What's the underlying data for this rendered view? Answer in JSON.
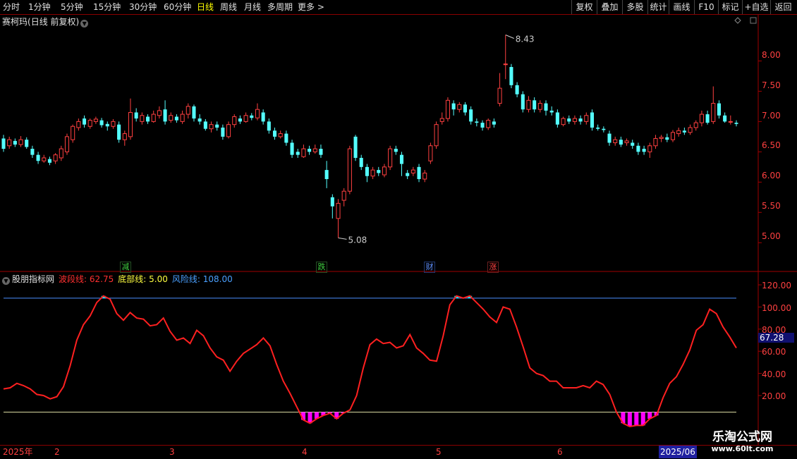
{
  "toolbar": {
    "periods": [
      "分时",
      "1分钟",
      "5分钟",
      "15分钟",
      "30分钟",
      "60分钟",
      "日线",
      "周线",
      "月线",
      "多周期",
      "更多"
    ],
    "active_period": "日线",
    "tools": [
      "复权",
      "叠加",
      "多股",
      "统计",
      "画线",
      "F10",
      "标记",
      "+自选",
      "返回"
    ]
  },
  "stock": {
    "name": "赛柯玛",
    "mode": "(日线 前复权)"
  },
  "price_axis": {
    "labels": [
      "8.00",
      "7.50",
      "7.00",
      "6.50",
      "6.00",
      "5.50",
      "5.00"
    ]
  },
  "annotations": {
    "high": "8.43",
    "low": "5.08"
  },
  "events": [
    {
      "label": "减",
      "color": "#40d040"
    },
    {
      "label": "跌",
      "color": "#40d040"
    },
    {
      "label": "财",
      "color": "#6090ff"
    },
    {
      "label": "涨",
      "color": "#ff4040"
    }
  ],
  "indicator": {
    "name": "股朋指标网",
    "wave_label": "波段线:",
    "wave_value": "62.75",
    "bottom_label": "底部线:",
    "bottom_value": "5.00",
    "risk_label": "风险线:",
    "risk_value": "108.00",
    "axis_labels": [
      "120.00",
      "100.00",
      "80.00",
      "60.00",
      "40.00",
      "20.00"
    ],
    "current_marker": "67.28"
  },
  "dates": {
    "labels": [
      "2025年",
      "2",
      "3",
      "4",
      "5",
      "6",
      "2025/06"
    ]
  },
  "watermark": {
    "line1": "乐淘公式网",
    "line2": "www.60lt.com"
  },
  "chart_data": {
    "type": "candlestick",
    "price_ylim": [
      4.7,
      8.75
    ],
    "indicator_ylim": [
      -5,
      125
    ],
    "wave_line": [
      26,
      27,
      31,
      29,
      26,
      21,
      20,
      17,
      19,
      28,
      47,
      70,
      84,
      92,
      104,
      110,
      107,
      94,
      88,
      95,
      90,
      89,
      83,
      84,
      90,
      78,
      70,
      72,
      67,
      79,
      74,
      63,
      55,
      52,
      42,
      51,
      58,
      62,
      66,
      72,
      65,
      48,
      33,
      22,
      10,
      -2,
      -5,
      -1,
      2,
      4,
      -1,
      4,
      7,
      20,
      45,
      66,
      71,
      67,
      68,
      63,
      65,
      75,
      63,
      58,
      52,
      51,
      74,
      102,
      110,
      108,
      110,
      104,
      98,
      91,
      86,
      100,
      98,
      82,
      64,
      45,
      40,
      38,
      33,
      33,
      27,
      27,
      27,
      29,
      27,
      33,
      30,
      21,
      5,
      -5,
      -8,
      -7,
      -7,
      -1,
      2,
      18,
      31,
      37,
      48,
      61,
      79,
      84,
      98,
      94,
      82,
      73,
      63
    ],
    "risk_line": 108,
    "bottom_line": 5,
    "candles": [
      [
        6.72,
        6.55,
        6.78,
        6.5
      ],
      [
        6.6,
        6.7,
        6.75,
        6.55
      ],
      [
        6.68,
        6.62,
        6.72,
        6.58
      ],
      [
        6.62,
        6.7,
        6.76,
        6.58
      ],
      [
        6.7,
        6.58,
        6.74,
        6.55
      ],
      [
        6.55,
        6.45,
        6.6,
        6.4
      ],
      [
        6.45,
        6.35,
        6.5,
        6.3
      ],
      [
        6.35,
        6.4,
        6.45,
        6.32
      ],
      [
        6.38,
        6.32,
        6.42,
        6.28
      ],
      [
        6.35,
        6.45,
        6.48,
        6.3
      ],
      [
        6.4,
        6.55,
        6.6,
        6.35
      ],
      [
        6.5,
        6.75,
        6.8,
        6.45
      ],
      [
        6.7,
        6.92,
        6.95,
        6.65
      ],
      [
        6.9,
        7.0,
        7.05,
        6.85
      ],
      [
        7.05,
        6.95,
        7.1,
        6.9
      ],
      [
        6.92,
        7.02,
        7.05,
        6.88
      ],
      [
        7.0,
        7.04,
        7.08,
        6.96
      ],
      [
        7.02,
        6.94,
        7.06,
        6.9
      ],
      [
        6.96,
        6.92,
        7.0,
        6.85
      ],
      [
        6.92,
        7.0,
        7.04,
        6.88
      ],
      [
        6.95,
        6.7,
        7.0,
        6.65
      ],
      [
        6.7,
        6.8,
        6.85,
        6.6
      ],
      [
        6.75,
        7.15,
        7.38,
        6.7
      ],
      [
        7.15,
        7.05,
        7.22,
        7.0
      ],
      [
        7.0,
        7.1,
        7.15,
        6.95
      ],
      [
        7.08,
        7.0,
        7.12,
        6.96
      ],
      [
        7.0,
        7.12,
        7.18,
        6.98
      ],
      [
        7.1,
        7.18,
        7.25,
        7.05
      ],
      [
        7.2,
        7.0,
        7.35,
        6.95
      ],
      [
        7.02,
        7.1,
        7.15,
        6.98
      ],
      [
        7.08,
        7.02,
        7.12,
        6.98
      ],
      [
        7.0,
        7.12,
        7.18,
        6.96
      ],
      [
        7.12,
        7.25,
        7.3,
        7.05
      ],
      [
        7.25,
        7.05,
        7.28,
        7.0
      ],
      [
        7.05,
        7.0,
        7.12,
        6.95
      ],
      [
        7.0,
        6.88,
        7.04,
        6.85
      ],
      [
        6.88,
        6.95,
        7.0,
        6.82
      ],
      [
        6.95,
        6.9,
        7.0,
        6.85
      ],
      [
        6.9,
        6.75,
        6.95,
        6.7
      ],
      [
        6.75,
        6.95,
        7.0,
        6.72
      ],
      [
        6.95,
        7.08,
        7.12,
        6.9
      ],
      [
        7.05,
        7.0,
        7.1,
        6.96
      ],
      [
        7.0,
        7.1,
        7.15,
        6.98
      ],
      [
        7.1,
        7.06,
        7.14,
        7.02
      ],
      [
        7.06,
        7.2,
        7.3,
        7.02
      ],
      [
        7.15,
        7.0,
        7.2,
        6.95
      ],
      [
        7.0,
        6.85,
        7.05,
        6.8
      ],
      [
        6.85,
        6.75,
        6.9,
        6.7
      ],
      [
        6.75,
        6.8,
        6.85,
        6.72
      ],
      [
        6.8,
        6.65,
        6.85,
        6.6
      ],
      [
        6.65,
        6.45,
        6.7,
        6.4
      ],
      [
        6.5,
        6.45,
        6.55,
        6.4
      ],
      [
        6.42,
        6.55,
        6.62,
        6.4
      ],
      [
        6.55,
        6.5,
        6.6,
        6.45
      ],
      [
        6.5,
        6.55,
        6.62,
        6.47
      ],
      [
        6.55,
        6.45,
        6.62,
        6.4
      ],
      [
        6.2,
        6.05,
        6.35,
        5.9
      ],
      [
        5.75,
        5.6,
        5.8,
        5.4
      ],
      [
        5.4,
        5.65,
        5.72,
        5.08
      ],
      [
        5.7,
        5.85,
        5.9,
        5.6
      ],
      [
        5.85,
        6.55,
        6.6,
        5.8
      ],
      [
        6.75,
        6.4,
        6.78,
        6.35
      ],
      [
        6.4,
        6.25,
        6.45,
        6.2
      ],
      [
        6.25,
        6.1,
        6.3,
        6.0
      ],
      [
        6.1,
        6.2,
        6.25,
        6.05
      ],
      [
        6.2,
        6.15,
        6.25,
        6.1
      ],
      [
        6.12,
        6.25,
        6.3,
        6.08
      ],
      [
        6.25,
        6.55,
        6.6,
        6.2
      ],
      [
        6.55,
        6.5,
        6.6,
        6.45
      ],
      [
        6.45,
        6.3,
        6.5,
        6.1
      ],
      [
        6.15,
        6.1,
        6.2,
        6.05
      ],
      [
        6.15,
        6.2,
        6.25,
        6.1
      ],
      [
        6.25,
        6.05,
        6.3,
        6.0
      ],
      [
        6.05,
        6.15,
        6.2,
        6.0
      ],
      [
        6.35,
        6.6,
        6.65,
        6.3
      ],
      [
        6.6,
        6.95,
        7.0,
        6.55
      ],
      [
        7.0,
        7.05,
        7.15,
        6.95
      ],
      [
        7.05,
        7.35,
        7.4,
        7.0
      ],
      [
        7.3,
        7.2,
        7.35,
        7.1
      ],
      [
        7.2,
        7.28,
        7.32,
        7.15
      ],
      [
        7.28,
        7.15,
        7.32,
        7.1
      ],
      [
        7.2,
        7.0,
        7.25,
        6.95
      ],
      [
        7.0,
        6.98,
        7.05,
        6.92
      ],
      [
        6.98,
        6.9,
        7.02,
        6.85
      ],
      [
        6.9,
        7.02,
        7.05,
        6.86
      ],
      [
        7.0,
        6.95,
        7.05,
        6.9
      ],
      [
        7.3,
        7.55,
        7.8,
        7.25
      ],
      [
        7.95,
        7.95,
        8.43,
        7.7
      ],
      [
        7.9,
        7.6,
        7.95,
        7.55
      ],
      [
        7.6,
        7.45,
        7.65,
        7.4
      ],
      [
        7.45,
        7.2,
        7.5,
        7.15
      ],
      [
        7.2,
        7.35,
        7.42,
        7.15
      ],
      [
        7.35,
        7.2,
        7.4,
        7.15
      ],
      [
        7.2,
        7.3,
        7.35,
        7.15
      ],
      [
        7.3,
        7.18,
        7.35,
        7.1
      ],
      [
        7.18,
        7.15,
        7.25,
        7.1
      ],
      [
        7.15,
        6.95,
        7.2,
        6.9
      ],
      [
        6.95,
        7.05,
        7.08,
        6.92
      ],
      [
        7.05,
        7.0,
        7.1,
        6.96
      ],
      [
        7.0,
        7.05,
        7.1,
        6.95
      ],
      [
        7.05,
        7.0,
        7.1,
        6.95
      ],
      [
        7.0,
        7.1,
        7.15,
        6.95
      ],
      [
        7.15,
        6.9,
        7.2,
        6.85
      ],
      [
        6.9,
        6.88,
        6.95,
        6.85
      ],
      [
        6.88,
        6.86,
        6.92,
        6.82
      ],
      [
        6.8,
        6.65,
        6.85,
        6.6
      ],
      [
        6.65,
        6.7,
        6.75,
        6.6
      ],
      [
        6.7,
        6.62,
        6.75,
        6.58
      ],
      [
        6.65,
        6.68,
        6.72,
        6.6
      ],
      [
        6.65,
        6.6,
        6.7,
        6.55
      ],
      [
        6.6,
        6.5,
        6.65,
        6.45
      ],
      [
        6.55,
        6.5,
        6.6,
        6.45
      ],
      [
        6.5,
        6.6,
        6.65,
        6.4
      ],
      [
        6.6,
        6.72,
        6.78,
        6.55
      ],
      [
        6.72,
        6.74,
        6.78,
        6.66
      ],
      [
        6.74,
        6.7,
        6.8,
        6.66
      ],
      [
        6.7,
        6.82,
        6.86,
        6.66
      ],
      [
        6.8,
        6.85,
        6.9,
        6.75
      ],
      [
        6.85,
        6.82,
        6.9,
        6.78
      ],
      [
        6.82,
        6.9,
        6.95,
        6.78
      ],
      [
        6.9,
        6.98,
        7.02,
        6.85
      ],
      [
        6.98,
        7.12,
        7.18,
        6.92
      ],
      [
        7.12,
        6.98,
        7.18,
        6.95
      ],
      [
        7.0,
        7.3,
        7.58,
        6.96
      ],
      [
        7.3,
        7.1,
        7.35,
        7.05
      ],
      [
        7.1,
        7.0,
        7.15,
        6.98
      ],
      [
        7.0,
        7.0,
        7.1,
        6.95
      ],
      [
        6.98,
        6.96,
        7.02,
        6.92
      ]
    ]
  }
}
